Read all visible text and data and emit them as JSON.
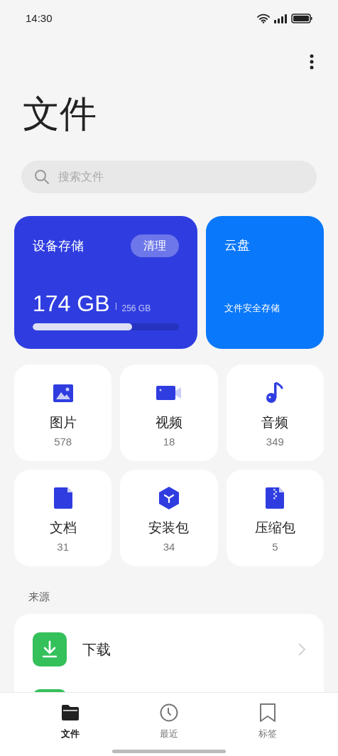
{
  "status_bar": {
    "time": "14:30"
  },
  "title": "文件",
  "search": {
    "placeholder": "搜索文件"
  },
  "storage": {
    "title": "设备存储",
    "clean_button": "清理",
    "used": "174 GB",
    "total": "256 GB",
    "level": 0.68
  },
  "cloud": {
    "title": "云盘",
    "subtitle": "文件安全存储"
  },
  "categories": [
    {
      "kind": "image",
      "label": "图片",
      "count": "578"
    },
    {
      "kind": "video",
      "label": "视频",
      "count": "18"
    },
    {
      "kind": "audio",
      "label": "音频",
      "count": "349"
    },
    {
      "kind": "document",
      "label": "文档",
      "count": "31"
    },
    {
      "kind": "package",
      "label": "安装包",
      "count": "34"
    },
    {
      "kind": "archive",
      "label": "压缩包",
      "count": "5"
    }
  ],
  "sources": {
    "heading": "来源",
    "items": [
      {
        "kind": "row",
        "label": "下载"
      },
      {
        "kind": "partial"
      }
    ]
  },
  "bottom_nav": [
    {
      "kind": "folder",
      "label": "文件",
      "selected": true
    },
    {
      "kind": "clock",
      "label": "最近",
      "selected": false
    },
    {
      "kind": "bookmark",
      "label": "标签",
      "selected": false
    }
  ]
}
